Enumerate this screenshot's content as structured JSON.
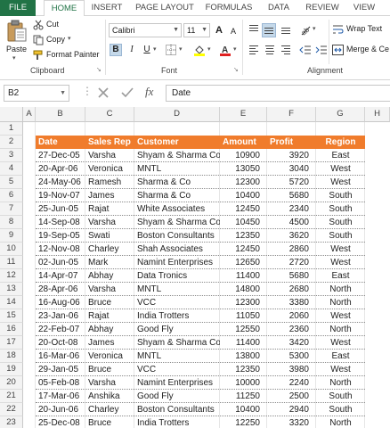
{
  "tabs": [
    "FILE",
    "HOME",
    "INSERT",
    "PAGE LAYOUT",
    "FORMULAS",
    "DATA",
    "REVIEW",
    "VIEW"
  ],
  "clipboard": {
    "paste_label": "Paste",
    "cut_label": "Cut",
    "copy_label": "Copy",
    "format_painter_label": "Format Painter",
    "group_label": "Clipboard"
  },
  "font": {
    "font_name": "Calibri",
    "font_size": "11",
    "bold": "B",
    "italic": "I",
    "underline": "U",
    "grow": "A",
    "shrink": "A",
    "group_label": "Font"
  },
  "alignment": {
    "wrap_text_label": "Wrap Text",
    "merge_label": "Merge & Ce",
    "group_label": "Alignment"
  },
  "formula_bar": {
    "name_box": "B2",
    "fx": "fx",
    "content": "Date"
  },
  "columns": [
    "A",
    "B",
    "C",
    "D",
    "E",
    "F",
    "G",
    "H"
  ],
  "rows": [
    "1",
    "2",
    "3",
    "4",
    "5",
    "6",
    "7",
    "8",
    "9",
    "10",
    "11",
    "12",
    "13",
    "14",
    "15",
    "16",
    "17",
    "18",
    "19",
    "20",
    "21",
    "22",
    "23"
  ],
  "table": {
    "headers": [
      "Date",
      "Sales Rep",
      "Customer",
      "Amount",
      "Profit",
      "Region"
    ],
    "rows": [
      [
        "27-Dec-05",
        "Varsha",
        "Shyam & Sharma Co",
        "10900",
        "3920",
        "East"
      ],
      [
        "20-Apr-06",
        "Veronica",
        "MNTL",
        "13050",
        "3040",
        "West"
      ],
      [
        "24-May-06",
        "Ramesh",
        "Sharma & Co",
        "12300",
        "5720",
        "West"
      ],
      [
        "19-Nov-07",
        "James",
        "Sharma & Co",
        "10400",
        "5680",
        "South"
      ],
      [
        "25-Jun-05",
        "Rajat",
        "White Associates",
        "12450",
        "2340",
        "South"
      ],
      [
        "14-Sep-08",
        "Varsha",
        "Shyam & Sharma Co",
        "10450",
        "4500",
        "South"
      ],
      [
        "19-Sep-05",
        "Swati",
        "Boston Consultants",
        "12350",
        "3620",
        "South"
      ],
      [
        "12-Nov-08",
        "Charley",
        "Shah Associates",
        "12450",
        "2860",
        "West"
      ],
      [
        "02-Jun-05",
        "Mark",
        "Namint Enterprises",
        "12650",
        "2720",
        "West"
      ],
      [
        "14-Apr-07",
        "Abhay",
        "Data Tronics",
        "11400",
        "5680",
        "East"
      ],
      [
        "28-Apr-06",
        "Varsha",
        "MNTL",
        "14800",
        "2680",
        "North"
      ],
      [
        "16-Aug-06",
        "Bruce",
        "VCC",
        "12300",
        "3380",
        "North"
      ],
      [
        "23-Jan-06",
        "Rajat",
        "India Trotters",
        "11050",
        "2060",
        "West"
      ],
      [
        "22-Feb-07",
        "Abhay",
        "Good Fly",
        "12550",
        "2360",
        "North"
      ],
      [
        "20-Oct-08",
        "James",
        "Shyam & Sharma Co",
        "11400",
        "3420",
        "West"
      ],
      [
        "16-Mar-06",
        "Veronica",
        "MNTL",
        "13800",
        "5300",
        "East"
      ],
      [
        "29-Jan-05",
        "Bruce",
        "VCC",
        "12350",
        "3980",
        "West"
      ],
      [
        "05-Feb-08",
        "Varsha",
        "Namint Enterprises",
        "10000",
        "2240",
        "North"
      ],
      [
        "17-Mar-06",
        "Anshika",
        "Good Fly",
        "11250",
        "2500",
        "South"
      ],
      [
        "20-Jun-06",
        "Charley",
        "Boston Consultants",
        "10400",
        "2940",
        "South"
      ],
      [
        "25-Dec-08",
        "Bruce",
        "India Trotters",
        "12250",
        "3320",
        "North"
      ]
    ]
  },
  "colors": {
    "file_tab": "#217346",
    "header_fill": "#f07c2c",
    "header_text": "#ffffff"
  }
}
